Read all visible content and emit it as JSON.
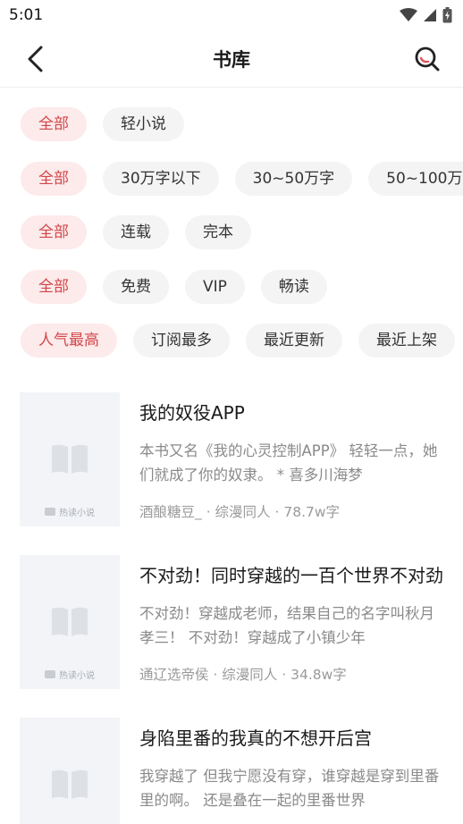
{
  "status": {
    "time": "5:01"
  },
  "header": {
    "title": "书库"
  },
  "filters": [
    [
      "全部",
      "轻小说"
    ],
    [
      "全部",
      "30万字以下",
      "30~50万字",
      "50~100万"
    ],
    [
      "全部",
      "连载",
      "完本"
    ],
    [
      "全部",
      "免费",
      "VIP",
      "畅读"
    ],
    [
      "人气最高",
      "订阅最多",
      "最近更新",
      "最近上架"
    ]
  ],
  "cover_watermark": "热读小说",
  "books": [
    {
      "title": "我的奴役APP",
      "desc": "本书又名《我的心灵控制APP》 轻轻一点，她们就成了你的奴隶。 * 喜多川海梦",
      "author": "酒酿糖豆_",
      "category": "综漫同人",
      "words": "78.7w字"
    },
    {
      "title": "不对劲！同时穿越的一百个世界不对劲",
      "desc": "不对劲！穿越成老师，结果自己的名字叫秋月孝三！ 不对劲！穿越成了小镇少年",
      "author": "通辽选帝侯",
      "category": "综漫同人",
      "words": "34.8w字"
    },
    {
      "title": "身陷里番的我真的不想开后宫",
      "desc": "我穿越了 但我宁愿没有穿，谁穿越是穿到里番里的啊。 还是叠在一起的里番世界",
      "author": "",
      "category": "",
      "words": ""
    }
  ]
}
